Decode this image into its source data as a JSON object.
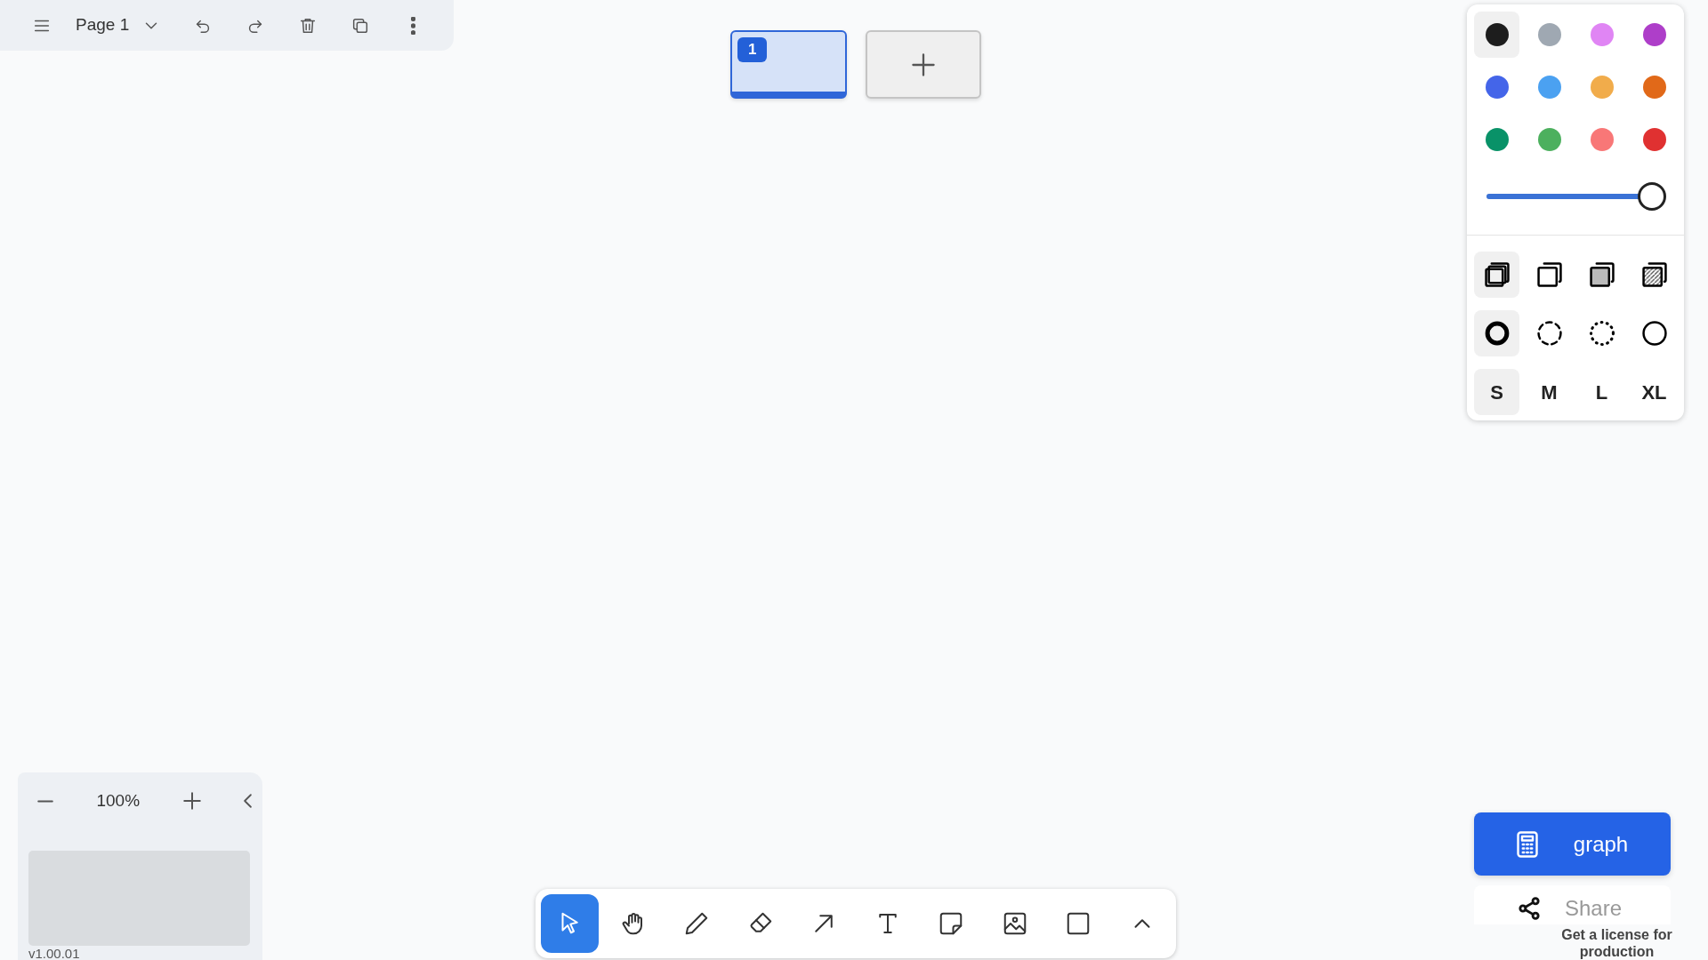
{
  "top_toolbar": {
    "page_name": "Page 1"
  },
  "pages": [
    {
      "label": "1",
      "selected": true
    }
  ],
  "style_panel": {
    "colors": [
      {
        "color": "#1d1d1d",
        "selected": true
      },
      {
        "color": "#9fa8b2",
        "selected": false
      },
      {
        "color": "#e085f4",
        "selected": false
      },
      {
        "color": "#ae3ec9",
        "selected": false
      },
      {
        "color": "#4465e9",
        "selected": false
      },
      {
        "color": "#4ba1f1",
        "selected": false
      },
      {
        "color": "#f1ac4b",
        "selected": false
      },
      {
        "color": "#e16919",
        "selected": false
      },
      {
        "color": "#099268",
        "selected": false
      },
      {
        "color": "#4cb05e",
        "selected": false
      },
      {
        "color": "#f87777",
        "selected": false
      },
      {
        "color": "#e03131",
        "selected": false
      }
    ],
    "opacity": {
      "level": 1
    },
    "fills": [
      {
        "kind": "none",
        "selected": true
      },
      {
        "kind": "semi",
        "selected": false
      },
      {
        "kind": "solid",
        "selected": false
      },
      {
        "kind": "pattern",
        "selected": false
      }
    ],
    "dashes": [
      {
        "kind": "draw",
        "selected": true
      },
      {
        "kind": "dashed",
        "selected": false
      },
      {
        "kind": "dotted",
        "selected": false
      },
      {
        "kind": "solid",
        "selected": false
      }
    ],
    "sizes": [
      {
        "label": "S",
        "selected": true
      },
      {
        "label": "M",
        "selected": false
      },
      {
        "label": "L",
        "selected": false
      },
      {
        "label": "XL",
        "selected": false
      }
    ]
  },
  "zoom": {
    "value": "100%",
    "version": "v1.00.01"
  },
  "tools": [
    {
      "kind": "select",
      "selected": true
    },
    {
      "kind": "hand",
      "selected": false
    },
    {
      "kind": "draw",
      "selected": false
    },
    {
      "kind": "eraser",
      "selected": false
    },
    {
      "kind": "arrow",
      "selected": false
    },
    {
      "kind": "text",
      "selected": false
    },
    {
      "kind": "note",
      "selected": false
    },
    {
      "kind": "image",
      "selected": false
    },
    {
      "kind": "rectangle",
      "selected": false
    },
    {
      "kind": "more",
      "selected": false
    }
  ],
  "actions": {
    "primary": "graph",
    "share": "Share",
    "license": "Get a license for production"
  }
}
